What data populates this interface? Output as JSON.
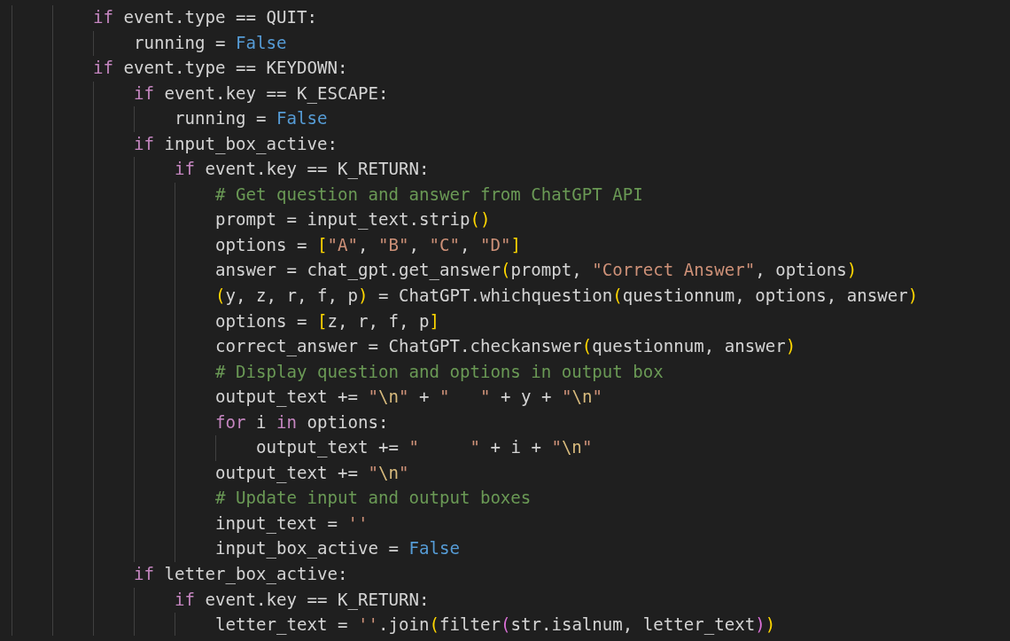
{
  "editor": {
    "lines": [
      {
        "tokens": [
          {
            "kind": "keyword",
            "text": "if"
          },
          {
            "kind": "plain",
            "text": " event.type == QUIT:"
          }
        ],
        "children": [
          {
            "tokens": [
              {
                "kind": "plain",
                "text": "running = "
              },
              {
                "kind": "constant",
                "text": "False"
              }
            ]
          }
        ]
      },
      {
        "tokens": [
          {
            "kind": "keyword",
            "text": "if"
          },
          {
            "kind": "plain",
            "text": " event.type == KEYDOWN:"
          }
        ],
        "children": [
          {
            "tokens": [
              {
                "kind": "keyword",
                "text": "if"
              },
              {
                "kind": "plain",
                "text": " event.key == K_ESCAPE:"
              }
            ],
            "children": [
              {
                "tokens": [
                  {
                    "kind": "plain",
                    "text": "running = "
                  },
                  {
                    "kind": "constant",
                    "text": "False"
                  }
                ]
              }
            ]
          },
          {
            "tokens": [
              {
                "kind": "keyword",
                "text": "if"
              },
              {
                "kind": "plain",
                "text": " input_box_active:"
              }
            ],
            "children": [
              {
                "tokens": [
                  {
                    "kind": "keyword",
                    "text": "if"
                  },
                  {
                    "kind": "plain",
                    "text": " event.key == K_RETURN:"
                  }
                ],
                "children": [
                  {
                    "tokens": [
                      {
                        "kind": "comment",
                        "text": "# Get question and answer from ChatGPT API"
                      }
                    ]
                  },
                  {
                    "tokens": [
                      {
                        "kind": "plain",
                        "text": "prompt = input_text.strip"
                      },
                      {
                        "kind": "bracket",
                        "text": "()"
                      }
                    ]
                  },
                  {
                    "tokens": [
                      {
                        "kind": "plain",
                        "text": "options = "
                      },
                      {
                        "kind": "bracket",
                        "text": "["
                      },
                      {
                        "kind": "string",
                        "text": "\"A\""
                      },
                      {
                        "kind": "plain",
                        "text": ", "
                      },
                      {
                        "kind": "string",
                        "text": "\"B\""
                      },
                      {
                        "kind": "plain",
                        "text": ", "
                      },
                      {
                        "kind": "string",
                        "text": "\"C\""
                      },
                      {
                        "kind": "plain",
                        "text": ", "
                      },
                      {
                        "kind": "string",
                        "text": "\"D\""
                      },
                      {
                        "kind": "bracket",
                        "text": "]"
                      }
                    ]
                  },
                  {
                    "tokens": [
                      {
                        "kind": "plain",
                        "text": "answer = chat_gpt.get_answer"
                      },
                      {
                        "kind": "bracket",
                        "text": "("
                      },
                      {
                        "kind": "plain",
                        "text": "prompt, "
                      },
                      {
                        "kind": "string",
                        "text": "\"Correct Answer\""
                      },
                      {
                        "kind": "plain",
                        "text": ", options"
                      },
                      {
                        "kind": "bracket",
                        "text": ")"
                      }
                    ]
                  },
                  {
                    "tokens": [
                      {
                        "kind": "bracket",
                        "text": "("
                      },
                      {
                        "kind": "plain",
                        "text": "y, z, r, f, p"
                      },
                      {
                        "kind": "bracket",
                        "text": ")"
                      },
                      {
                        "kind": "plain",
                        "text": " = ChatGPT.whichquestion"
                      },
                      {
                        "kind": "bracket",
                        "text": "("
                      },
                      {
                        "kind": "plain",
                        "text": "questionnum, options, answer"
                      },
                      {
                        "kind": "bracket",
                        "text": ")"
                      }
                    ]
                  },
                  {
                    "tokens": [
                      {
                        "kind": "plain",
                        "text": "options = "
                      },
                      {
                        "kind": "bracket",
                        "text": "["
                      },
                      {
                        "kind": "plain",
                        "text": "z, r, f, p"
                      },
                      {
                        "kind": "bracket",
                        "text": "]"
                      }
                    ]
                  },
                  {
                    "tokens": [
                      {
                        "kind": "plain",
                        "text": "correct_answer = ChatGPT.checkanswer"
                      },
                      {
                        "kind": "bracket",
                        "text": "("
                      },
                      {
                        "kind": "plain",
                        "text": "questionnum, answer"
                      },
                      {
                        "kind": "bracket",
                        "text": ")"
                      }
                    ]
                  },
                  {
                    "tokens": [
                      {
                        "kind": "comment",
                        "text": "# Display question and options in output box"
                      }
                    ]
                  },
                  {
                    "tokens": [
                      {
                        "kind": "plain",
                        "text": "output_text += "
                      },
                      {
                        "kind": "string",
                        "text": "\""
                      },
                      {
                        "kind": "escape",
                        "text": "\\n"
                      },
                      {
                        "kind": "string",
                        "text": "\""
                      },
                      {
                        "kind": "plain",
                        "text": " + "
                      },
                      {
                        "kind": "string",
                        "text": "\"   \""
                      },
                      {
                        "kind": "plain",
                        "text": " + y + "
                      },
                      {
                        "kind": "string",
                        "text": "\""
                      },
                      {
                        "kind": "escape",
                        "text": "\\n"
                      },
                      {
                        "kind": "string",
                        "text": "\""
                      }
                    ]
                  },
                  {
                    "tokens": [
                      {
                        "kind": "keyword",
                        "text": "for"
                      },
                      {
                        "kind": "plain",
                        "text": " i "
                      },
                      {
                        "kind": "keyword",
                        "text": "in"
                      },
                      {
                        "kind": "plain",
                        "text": " options:"
                      }
                    ],
                    "children": [
                      {
                        "tokens": [
                          {
                            "kind": "plain",
                            "text": "output_text += "
                          },
                          {
                            "kind": "string",
                            "text": "\"     \""
                          },
                          {
                            "kind": "plain",
                            "text": " + i + "
                          },
                          {
                            "kind": "string",
                            "text": "\""
                          },
                          {
                            "kind": "escape",
                            "text": "\\n"
                          },
                          {
                            "kind": "string",
                            "text": "\""
                          }
                        ]
                      }
                    ]
                  },
                  {
                    "tokens": [
                      {
                        "kind": "plain",
                        "text": "output_text += "
                      },
                      {
                        "kind": "string",
                        "text": "\""
                      },
                      {
                        "kind": "escape",
                        "text": "\\n"
                      },
                      {
                        "kind": "string",
                        "text": "\""
                      }
                    ]
                  },
                  {
                    "tokens": [
                      {
                        "kind": "comment",
                        "text": "# Update input and output boxes"
                      }
                    ]
                  },
                  {
                    "tokens": [
                      {
                        "kind": "plain",
                        "text": "input_text = "
                      },
                      {
                        "kind": "string",
                        "text": "''"
                      }
                    ]
                  },
                  {
                    "tokens": [
                      {
                        "kind": "plain",
                        "text": "input_box_active = "
                      },
                      {
                        "kind": "constant",
                        "text": "False"
                      }
                    ]
                  }
                ]
              }
            ]
          },
          {
            "tokens": [
              {
                "kind": "keyword",
                "text": "if"
              },
              {
                "kind": "plain",
                "text": " letter_box_active:"
              }
            ],
            "children": [
              {
                "tokens": [
                  {
                    "kind": "keyword",
                    "text": "if"
                  },
                  {
                    "kind": "plain",
                    "text": " event.key == K_RETURN:"
                  }
                ],
                "children": [
                  {
                    "tokens": [
                      {
                        "kind": "plain",
                        "text": "letter_text = "
                      },
                      {
                        "kind": "string",
                        "text": "''"
                      },
                      {
                        "kind": "plain",
                        "text": ".join"
                      },
                      {
                        "kind": "bracket",
                        "text": "("
                      },
                      {
                        "kind": "plain",
                        "text": "filter"
                      },
                      {
                        "kind": "bracket2",
                        "text": "("
                      },
                      {
                        "kind": "plain",
                        "text": "str.isalnum, letter_text"
                      },
                      {
                        "kind": "bracket2",
                        "text": ")"
                      },
                      {
                        "kind": "bracket",
                        "text": ")"
                      }
                    ]
                  }
                ]
              }
            ]
          }
        ]
      }
    ]
  }
}
